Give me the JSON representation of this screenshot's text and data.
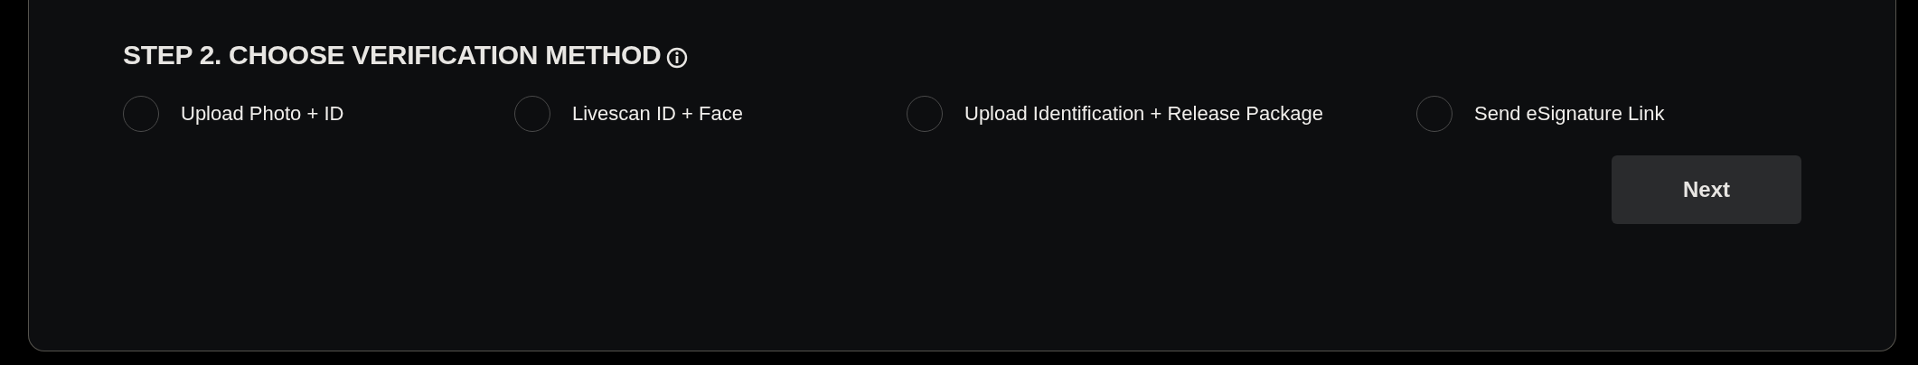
{
  "section": {
    "title": "STEP 2. CHOOSE VERIFICATION METHOD"
  },
  "options": [
    {
      "label": "Upload Photo + ID",
      "selected": false
    },
    {
      "label": "Livescan ID + Face",
      "selected": false
    },
    {
      "label": "Upload Identification + Release Package",
      "selected": false
    },
    {
      "label": "Send eSignature Link",
      "selected": false
    }
  ],
  "buttons": [
    {
      "label": "Next"
    }
  ]
}
